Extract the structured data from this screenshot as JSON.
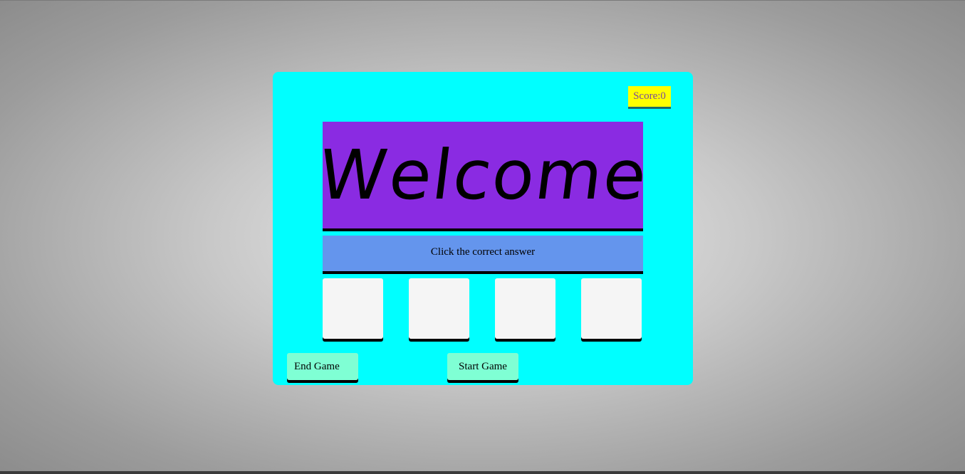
{
  "score": {
    "label": "Score:",
    "value": "0"
  },
  "question": {
    "text": "Welcome"
  },
  "instruction": {
    "text": "Click the correct answer"
  },
  "choices": [
    "",
    "",
    "",
    ""
  ],
  "buttons": {
    "end_label": "End Game",
    "start_label": "Start Game"
  },
  "colors": {
    "container": "#00ffff",
    "score_bg": "#ffff00",
    "question_bg": "#8a2be2",
    "instruction_bg": "#6495ed",
    "choice_bg": "#f5f5f5",
    "button_bg": "#7fffd4"
  }
}
